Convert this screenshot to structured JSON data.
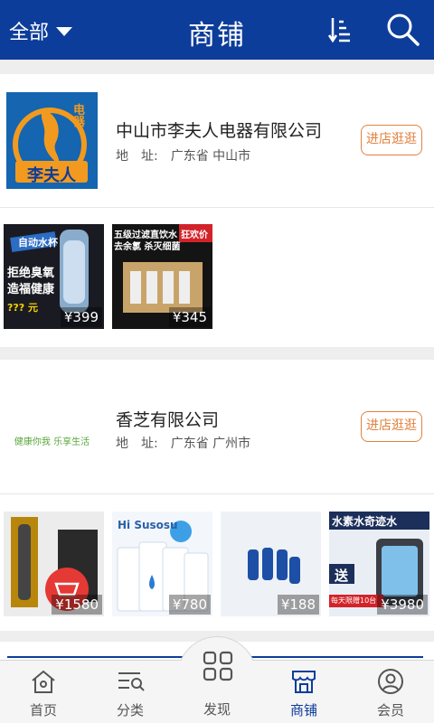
{
  "header": {
    "category_label": "全部",
    "title": "商铺",
    "sort_icon": "sort-icon",
    "search_icon": "search-icon",
    "bg_color": "#0d3d9a"
  },
  "shops": [
    {
      "name": "中山市李夫人电器有限公司",
      "address_label": "地　址:",
      "address": "广东省 中山市",
      "visit_label": "进店逛逛",
      "logo_text": "李夫人",
      "logo_side_text": "电器",
      "products": [
        {
          "price": "¥399",
          "banner_top": "自动水杯",
          "banner_main": "拒绝臭氧 造福健康",
          "banner_sub": "??? 元"
        },
        {
          "price": "¥345",
          "banner_top": "五级过滤直饮水 去余氯 杀灭细菌",
          "banner_tag": "狂欢价"
        }
      ]
    },
    {
      "name": "香芝有限公司",
      "address_label": "地　址:",
      "address": "广东省 广州市",
      "visit_label": "进店逛逛",
      "logo_text": "健康你我 乐享生活",
      "products": [
        {
          "price": "¥1580"
        },
        {
          "price": "¥780",
          "banner_top": "Hi Susosu"
        },
        {
          "price": "¥188"
        },
        {
          "price": "¥3980",
          "banner_top": "水素水奇迹水",
          "banner_mid": "送",
          "banner_sub": "每天限赠10台"
        }
      ]
    }
  ],
  "bottom_nav": {
    "items": [
      {
        "label": "首页",
        "icon": "home-icon"
      },
      {
        "label": "分类",
        "icon": "category-icon"
      },
      {
        "label": "发现",
        "icon": "grid-icon"
      },
      {
        "label": "商铺",
        "icon": "shop-icon"
      },
      {
        "label": "会员",
        "icon": "user-icon"
      }
    ],
    "active_index": 3,
    "active_color": "#0d3d9a"
  },
  "accent_color": "#e2823e"
}
